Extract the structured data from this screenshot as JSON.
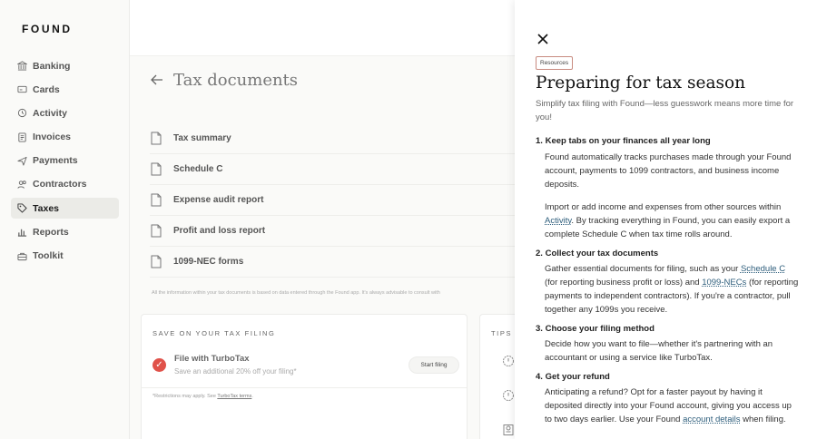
{
  "app": {
    "logo": "FOUND"
  },
  "sidebar": {
    "items": [
      {
        "label": "Banking",
        "icon": "bank-icon"
      },
      {
        "label": "Cards",
        "icon": "card-icon"
      },
      {
        "label": "Activity",
        "icon": "clock-icon"
      },
      {
        "label": "Invoices",
        "icon": "document-icon"
      },
      {
        "label": "Payments",
        "icon": "send-icon"
      },
      {
        "label": "Contractors",
        "icon": "people-icon"
      },
      {
        "label": "Taxes",
        "icon": "tag-icon",
        "active": true
      },
      {
        "label": "Reports",
        "icon": "bar-chart-icon"
      },
      {
        "label": "Toolkit",
        "icon": "toolbox-icon"
      }
    ]
  },
  "main": {
    "title": "Tax documents",
    "documents": [
      "Tax summary",
      "Schedule C",
      "Expense audit report",
      "Profit and loss report",
      "1099-NEC forms"
    ],
    "disclaimer": "All the information within your tax documents is based on data entered through the Found app. It's always advisable to consult with",
    "save_card": {
      "heading": "SAVE ON YOUR TAX FILING",
      "turbotax_title": "File with TurboTax",
      "turbotax_sub": "Save an additional 20% off your filing*",
      "button": "Start filing",
      "restrictions_prefix": "*Restrictions may apply. See ",
      "restrictions_link": "TurboTax terms",
      "restrictions_suffix": "."
    },
    "tips_card": {
      "heading": "TIPS"
    }
  },
  "panel": {
    "badge": "Resources",
    "title": "Preparing for tax season",
    "subtitle": "Simplify tax filing with Found—less guesswork means more time for you!",
    "steps": [
      {
        "num": "1.",
        "title": "Keep tabs on your finances all year long",
        "p1": "Found automatically tracks purchases made through your Found account, payments to 1099 contractors, and business income deposits.",
        "p2_a": "Import or add income and expenses from other sources within ",
        "p2_link": "Activity",
        "p2_b": ". By tracking everything in Found, you can easily export a complete Schedule C when tax time rolls around."
      },
      {
        "num": "2.",
        "title": "Collect your tax documents",
        "p1_a": "Gather essential documents for filing, such as your ",
        "p1_link1": "Schedule C",
        "p1_b": " (for reporting business profit or loss) and ",
        "p1_link2": "1099-NECs",
        "p1_c": " (for reporting payments to independent contractors). If you're a contractor, pull together any 1099s you receive."
      },
      {
        "num": "3.",
        "title": "Choose your filing method",
        "p1": "Decide how you want to file—whether it's partnering with an accountant or using a service like TurboTax."
      },
      {
        "num": "4.",
        "title": "Get your refund",
        "p1_a": "Anticipating a refund? Opt for a faster payout by having it deposited directly into your Found account, giving you access up to two days earlier. Use your Found ",
        "p1_link": "account details",
        "p1_b": " when filing."
      }
    ]
  },
  "colors": {
    "accent": "#e0524a",
    "link": "#2d5d7b",
    "badge_border": "#c88b80"
  }
}
